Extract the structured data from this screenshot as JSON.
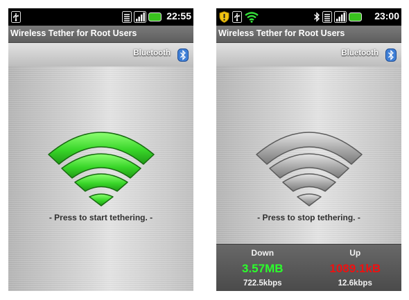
{
  "left_screen": {
    "status_time": "22:55",
    "app_title": "Wireless Tether for Root Users",
    "bluetooth_label": "Bluetooth",
    "hint": "- Press to start tethering. -",
    "tethering_active": false
  },
  "right_screen": {
    "status_time": "23:00",
    "app_title": "Wireless Tether for Root Users",
    "bluetooth_label": "Bluetooth",
    "hint": "- Press to stop tethering. -",
    "tethering_active": true,
    "traffic": {
      "down_label": "Down",
      "down_total": "3.57MB",
      "down_rate": "722.5kbps",
      "up_label": "Up",
      "up_total": "1089.1kB",
      "up_rate": "12.6kbps"
    }
  },
  "colors": {
    "wifi_on": "#39d629",
    "wifi_off": "#a7a7a7",
    "down_value": "#2bff2b",
    "up_value": "#ee1111",
    "battery": "#39c21e"
  },
  "icons": [
    "usb-icon",
    "signal-icon",
    "battery-icon",
    "warning-shield-icon",
    "wifi-status-icon",
    "bluetooth-icon",
    "wifi-tether-icon"
  ]
}
